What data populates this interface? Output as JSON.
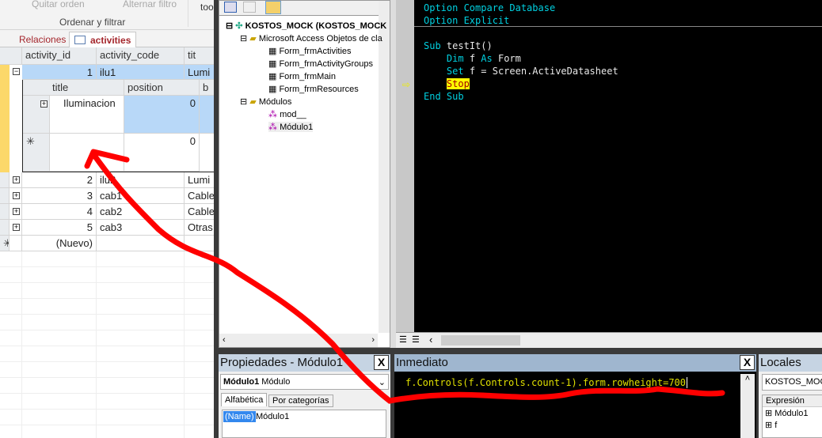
{
  "ribbon": {
    "sort_clear": "Quitar orden",
    "toggle_filter": "Alternar filtro",
    "group_label": "Ordenar y filtrar",
    "cut_text": "too"
  },
  "tabs": [
    {
      "label": "Relaciones"
    },
    {
      "label": "activities"
    }
  ],
  "datasheet": {
    "columns": [
      "activity_id",
      "activity_code",
      "tit"
    ],
    "rows": [
      {
        "id": "1",
        "code": "ilu1",
        "title": "Lumi"
      },
      {
        "id": "2",
        "code": "ilu2",
        "title": "Lumi"
      },
      {
        "id": "3",
        "code": "cab1",
        "title": "Cable"
      },
      {
        "id": "4",
        "code": "cab2",
        "title": "Cable"
      },
      {
        "id": "5",
        "code": "cab3",
        "title": "Otras"
      }
    ],
    "new_row": "(Nuevo)",
    "sub": {
      "columns": [
        "title",
        "position",
        "b"
      ],
      "rows": [
        {
          "title": "Iluminacion",
          "position": "0"
        }
      ],
      "new_position": "0"
    }
  },
  "project": {
    "root": "KOSTOS_MOCK (KOSTOS_MOCK",
    "folder1": "Microsoft Access Objetos de cla",
    "forms": [
      "Form_frmActivities",
      "Form_frmActivityGroups",
      "Form_frmMain",
      "Form_frmResources"
    ],
    "folder2": "Módulos",
    "modules": [
      "mod__",
      "Módulo1"
    ]
  },
  "code": {
    "lines": [
      "Option Compare Database",
      "Option Explicit"
    ],
    "sub_kw": "Sub",
    "sub_name": "testIt()",
    "dim_kw": "Dim",
    "dim_var": "f",
    "as_kw": "As",
    "dim_type": "Form",
    "set_kw": "Set",
    "set_rest": "f = Screen.ActiveDatasheet",
    "stop": "Stop",
    "end": "End Sub"
  },
  "properties": {
    "title": "Propiedades - Módulo1",
    "object": "Módulo1",
    "object_type": "Módulo",
    "tabs": [
      "Alfabética",
      "Por categorías"
    ],
    "prop_name": "(Name)",
    "prop_value": "Módulo1"
  },
  "immediate": {
    "title": "Inmediato",
    "text": "f.Controls(f.Controls.count-1).form.rowheight=700"
  },
  "locals": {
    "title": "Locales",
    "context": "KOSTOS_MOCK",
    "column": "Expresión",
    "items": [
      "Módulo1",
      "f"
    ]
  },
  "colors": {
    "annotation": "#ff0000",
    "selection": "#b8d8f8",
    "record_indicator": "#fcd86a"
  }
}
